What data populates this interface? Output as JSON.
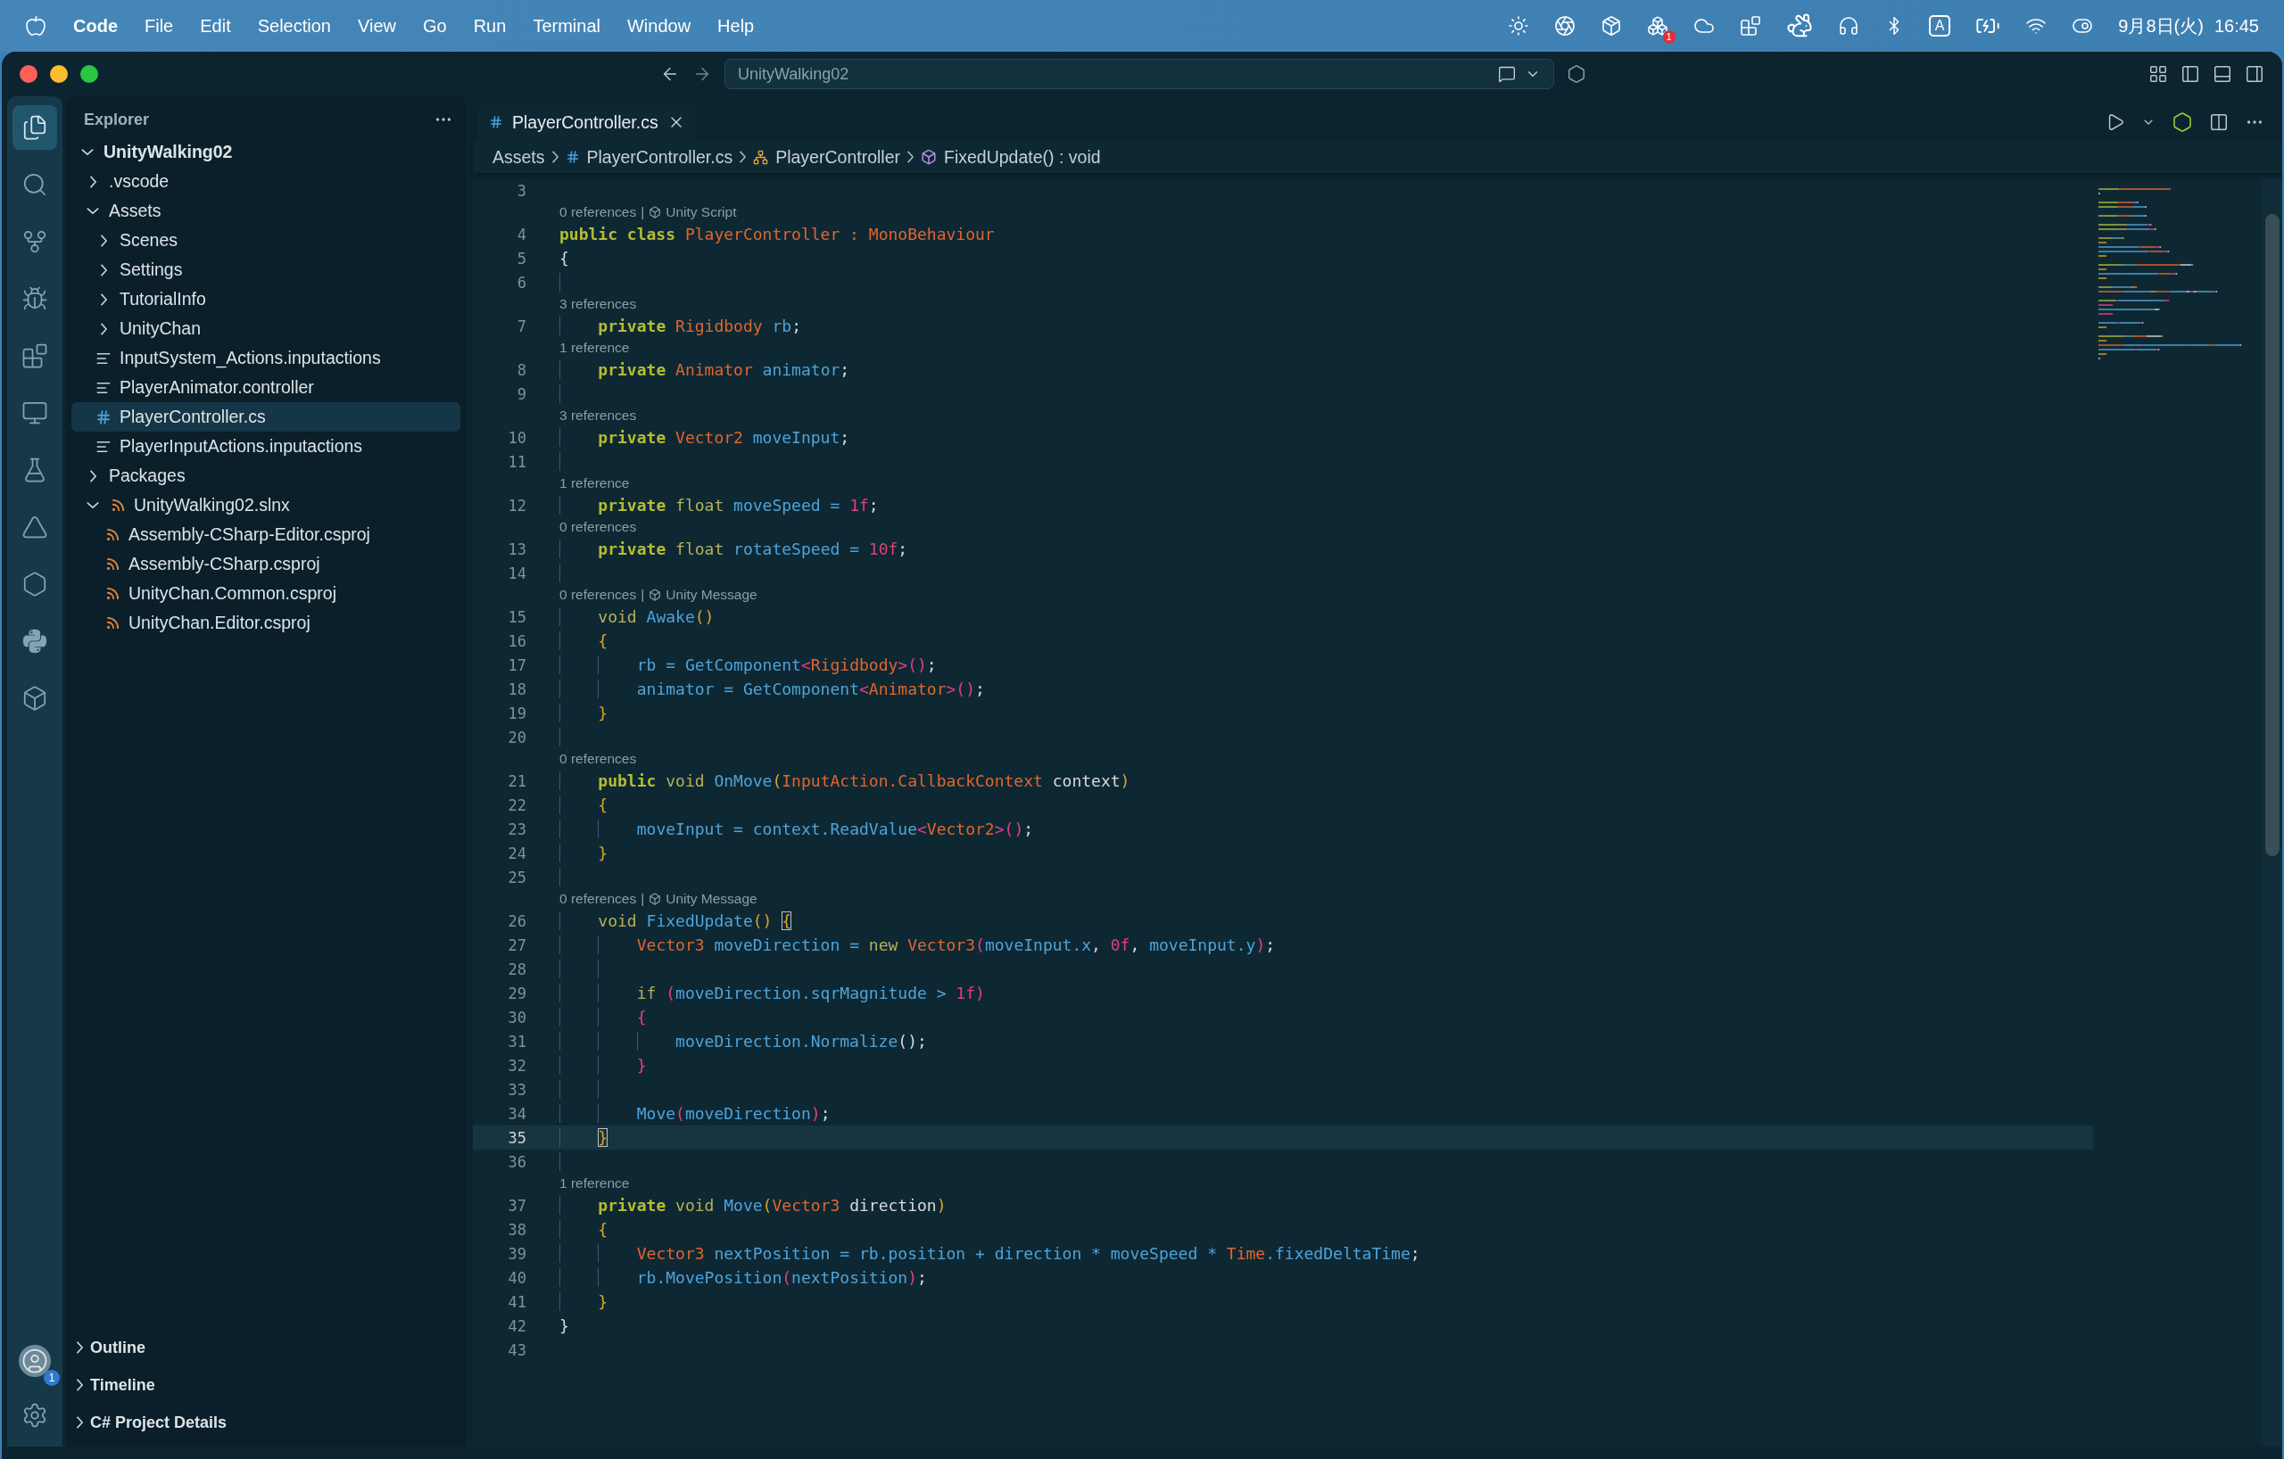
{
  "menu_bar": {
    "app": "Code",
    "items": [
      "File",
      "Edit",
      "Selection",
      "View",
      "Go",
      "Run",
      "Terminal",
      "Window",
      "Help"
    ],
    "tray_badge": "1",
    "input_mode": "A",
    "date": "9月8日(火)",
    "time": "16:45"
  },
  "title_bar": {
    "search": "UnityWalking02"
  },
  "activity_bar": [
    {
      "kind": "explorer",
      "selected": true
    },
    {
      "kind": "search",
      "selected": false
    },
    {
      "kind": "source-control",
      "selected": false
    },
    {
      "kind": "debug",
      "selected": false
    },
    {
      "kind": "extensions",
      "selected": false
    },
    {
      "kind": "remote",
      "selected": false
    },
    {
      "kind": "testing",
      "selected": false
    },
    {
      "kind": "triangle",
      "selected": false
    },
    {
      "kind": "hexagon",
      "selected": false
    },
    {
      "kind": "python",
      "selected": false
    },
    {
      "kind": "box",
      "selected": false
    }
  ],
  "account_badge": "1",
  "sidebar": {
    "title": "Explorer",
    "tree": [
      {
        "label": "UnityWalking02",
        "kind": "root",
        "expanded": true,
        "selected": false,
        "children": [
          {
            "label": ".vscode",
            "kind": "folder",
            "expanded": false,
            "selected": false
          },
          {
            "label": "Assets",
            "kind": "folder",
            "expanded": true,
            "selected": false,
            "children": [
              {
                "label": "Scenes",
                "kind": "folder",
                "expanded": false,
                "selected": false
              },
              {
                "label": "Settings",
                "kind": "folder",
                "expanded": false,
                "selected": false
              },
              {
                "label": "TutorialInfo",
                "kind": "folder",
                "expanded": false,
                "selected": false
              },
              {
                "label": "UnityChan",
                "kind": "folder",
                "expanded": false,
                "selected": false
              },
              {
                "label": "InputSystem_Actions.inputactions",
                "kind": "text",
                "selected": false
              },
              {
                "label": "PlayerAnimator.controller",
                "kind": "text",
                "selected": false
              },
              {
                "label": "PlayerController.cs",
                "kind": "csharp",
                "selected": true
              },
              {
                "label": "PlayerInputActions.inputactions",
                "kind": "text",
                "selected": false
              }
            ]
          },
          {
            "label": "Packages",
            "kind": "folder",
            "expanded": false,
            "selected": false
          },
          {
            "label": "UnityWalking02.slnx",
            "kind": "solution",
            "expanded": true,
            "selected": false,
            "children": [
              {
                "label": "Assembly-CSharp-Editor.csproj",
                "kind": "project",
                "selected": false
              },
              {
                "label": "Assembly-CSharp.csproj",
                "kind": "project",
                "selected": false
              },
              {
                "label": "UnityChan.Common.csproj",
                "kind": "project",
                "selected": false
              },
              {
                "label": "UnityChan.Editor.csproj",
                "kind": "project",
                "selected": false
              }
            ]
          }
        ]
      }
    ],
    "sections": [
      {
        "label": "Outline",
        "expanded": false
      },
      {
        "label": "Timeline",
        "expanded": false
      },
      {
        "label": "C# Project Details",
        "expanded": false
      }
    ]
  },
  "editor": {
    "tabs": [
      {
        "label": "PlayerController.cs",
        "selected": true
      }
    ],
    "breadcrumbs": [
      {
        "label": "Assets",
        "kind": "folder"
      },
      {
        "label": "PlayerController.cs",
        "kind": "csharp"
      },
      {
        "label": "PlayerController",
        "kind": "class"
      },
      {
        "label": "FixedUpdate() : void",
        "kind": "method"
      }
    ],
    "lines": [
      {
        "number": "3",
        "current": false
      },
      {
        "number": "4",
        "current": false,
        "lens": {
          "references": "0 references",
          "separator": "|",
          "tag": "Unity Script"
        },
        "tokens": [
          {
            "kind": "keyword",
            "text": "public class "
          },
          {
            "kind": "type",
            "text": "PlayerController : MonoBehaviour"
          }
        ]
      },
      {
        "number": "5",
        "current": false,
        "tokens": [
          {
            "kind": "plain",
            "text": "{"
          }
        ]
      },
      {
        "number": "6",
        "current": false
      },
      {
        "number": "7",
        "current": false,
        "lens": {
          "references": "3 references"
        },
        "tokens": [
          {
            "kind": "keyword",
            "text": "    private "
          },
          {
            "kind": "type",
            "text": "Rigidbody "
          },
          {
            "kind": "name",
            "text": "rb"
          },
          {
            "kind": "plain",
            "text": ";"
          }
        ]
      },
      {
        "number": "8",
        "current": false,
        "lens": {
          "references": "1 reference"
        },
        "tokens": [
          {
            "kind": "keyword",
            "text": "    private "
          },
          {
            "kind": "type",
            "text": "Animator "
          },
          {
            "kind": "name",
            "text": "animator"
          },
          {
            "kind": "plain",
            "text": ";"
          }
        ]
      },
      {
        "number": "9",
        "current": false
      },
      {
        "number": "10",
        "current": false,
        "lens": {
          "references": "3 references"
        },
        "tokens": [
          {
            "kind": "keyword",
            "text": "    private "
          },
          {
            "kind": "type",
            "text": "Vector2 "
          },
          {
            "kind": "name",
            "text": "moveInput"
          },
          {
            "kind": "plain",
            "text": ";"
          }
        ]
      },
      {
        "number": "11",
        "current": false
      },
      {
        "number": "12",
        "current": false,
        "lens": {
          "references": "1 reference"
        },
        "tokens": [
          {
            "kind": "keyword",
            "text": "    private "
          },
          {
            "kind": "modifier",
            "text": "float "
          },
          {
            "kind": "name",
            "text": "moveSpeed"
          },
          {
            "kind": "operator",
            "text": " = "
          },
          {
            "kind": "number",
            "text": "1f"
          },
          {
            "kind": "plain",
            "text": ";"
          }
        ]
      },
      {
        "number": "13",
        "current": false,
        "lens": {
          "references": "0 references"
        },
        "tokens": [
          {
            "kind": "keyword",
            "text": "    private "
          },
          {
            "kind": "modifier",
            "text": "float "
          },
          {
            "kind": "name",
            "text": "rotateSpeed"
          },
          {
            "kind": "operator",
            "text": " = "
          },
          {
            "kind": "number",
            "text": "10f"
          },
          {
            "kind": "plain",
            "text": ";"
          }
        ]
      },
      {
        "number": "14",
        "current": false
      },
      {
        "number": "15",
        "current": false,
        "lens": {
          "references": "0 references",
          "separator": "|",
          "tag": "Unity Message"
        },
        "tokens": [
          {
            "kind": "modifier",
            "text": "    void "
          },
          {
            "kind": "name",
            "text": "Awake"
          },
          {
            "kind": "brace",
            "text": "()"
          }
        ]
      },
      {
        "number": "16",
        "current": false,
        "tokens": [
          {
            "kind": "brace",
            "text": "    {"
          }
        ]
      },
      {
        "number": "17",
        "current": false,
        "tokens": [
          {
            "kind": "name",
            "text": "        rb"
          },
          {
            "kind": "operator",
            "text": " = "
          },
          {
            "kind": "name",
            "text": "GetComponent"
          },
          {
            "kind": "bracket",
            "text": "<"
          },
          {
            "kind": "type",
            "text": "Rigidbody"
          },
          {
            "kind": "bracket",
            "text": ">()"
          },
          {
            "kind": "plain",
            "text": ";"
          }
        ]
      },
      {
        "number": "18",
        "current": false,
        "tokens": [
          {
            "kind": "name",
            "text": "        animator"
          },
          {
            "kind": "operator",
            "text": " = "
          },
          {
            "kind": "name",
            "text": "GetComponent"
          },
          {
            "kind": "bracket",
            "text": "<"
          },
          {
            "kind": "type",
            "text": "Animator"
          },
          {
            "kind": "bracket",
            "text": ">()"
          },
          {
            "kind": "plain",
            "text": ";"
          }
        ]
      },
      {
        "number": "19",
        "current": false,
        "tokens": [
          {
            "kind": "brace",
            "text": "    }"
          }
        ]
      },
      {
        "number": "20",
        "current": false
      },
      {
        "number": "21",
        "current": false,
        "lens": {
          "references": "0 references"
        },
        "tokens": [
          {
            "kind": "keyword",
            "text": "    public "
          },
          {
            "kind": "modifier",
            "text": "void "
          },
          {
            "kind": "name",
            "text": "OnMove"
          },
          {
            "kind": "brace",
            "text": "("
          },
          {
            "kind": "type",
            "text": "InputAction.CallbackContext "
          },
          {
            "kind": "plain",
            "text": "context"
          },
          {
            "kind": "brace",
            "text": ")"
          }
        ]
      },
      {
        "number": "22",
        "current": false,
        "tokens": [
          {
            "kind": "brace",
            "text": "    {"
          }
        ]
      },
      {
        "number": "23",
        "current": false,
        "tokens": [
          {
            "kind": "name",
            "text": "        moveInput"
          },
          {
            "kind": "operator",
            "text": " = "
          },
          {
            "kind": "name",
            "text": "context.ReadValue"
          },
          {
            "kind": "bracket",
            "text": "<"
          },
          {
            "kind": "type",
            "text": "Vector2"
          },
          {
            "kind": "bracket",
            "text": ">()"
          },
          {
            "kind": "plain",
            "text": ";"
          }
        ]
      },
      {
        "number": "24",
        "current": false,
        "tokens": [
          {
            "kind": "brace",
            "text": "    }"
          }
        ]
      },
      {
        "number": "25",
        "current": false
      },
      {
        "number": "26",
        "current": false,
        "lens": {
          "references": "0 references",
          "separator": "|",
          "tag": "Unity Message"
        },
        "tokens": [
          {
            "kind": "modifier",
            "text": "    void "
          },
          {
            "kind": "name",
            "text": "FixedUpdate"
          },
          {
            "kind": "brace",
            "text": "() "
          },
          {
            "kind": "match",
            "text": "{"
          }
        ]
      },
      {
        "number": "27",
        "current": false,
        "tokens": [
          {
            "kind": "type",
            "text": "        Vector3 "
          },
          {
            "kind": "name",
            "text": "moveDirection"
          },
          {
            "kind": "operator",
            "text": " = "
          },
          {
            "kind": "modifier",
            "text": "new "
          },
          {
            "kind": "type",
            "text": "Vector3"
          },
          {
            "kind": "bracket",
            "text": "("
          },
          {
            "kind": "name",
            "text": "moveInput.x"
          },
          {
            "kind": "plain",
            "text": ", "
          },
          {
            "kind": "number",
            "text": "0f"
          },
          {
            "kind": "plain",
            "text": ", "
          },
          {
            "kind": "name",
            "text": "moveInput.y"
          },
          {
            "kind": "bracket",
            "text": ")"
          },
          {
            "kind": "plain",
            "text": ";"
          }
        ]
      },
      {
        "number": "28",
        "current": false
      },
      {
        "number": "29",
        "current": false,
        "tokens": [
          {
            "kind": "modifier",
            "text": "        if "
          },
          {
            "kind": "bracket",
            "text": "("
          },
          {
            "kind": "name",
            "text": "moveDirection.sqrMagnitude"
          },
          {
            "kind": "operator",
            "text": " > "
          },
          {
            "kind": "number",
            "text": "1f"
          },
          {
            "kind": "bracket",
            "text": ")"
          }
        ]
      },
      {
        "number": "30",
        "current": false,
        "tokens": [
          {
            "kind": "bracket",
            "text": "        {"
          }
        ]
      },
      {
        "number": "31",
        "current": false,
        "tokens": [
          {
            "kind": "name",
            "text": "            moveDirection.Normalize"
          },
          {
            "kind": "plain",
            "text": "();"
          }
        ]
      },
      {
        "number": "32",
        "current": false,
        "tokens": [
          {
            "kind": "bracket",
            "text": "        }"
          }
        ]
      },
      {
        "number": "33",
        "current": false
      },
      {
        "number": "34",
        "current": false,
        "tokens": [
          {
            "kind": "name",
            "text": "        Move"
          },
          {
            "kind": "bracket",
            "text": "("
          },
          {
            "kind": "name",
            "text": "moveDirection"
          },
          {
            "kind": "bracket",
            "text": ")"
          },
          {
            "kind": "plain",
            "text": ";"
          }
        ]
      },
      {
        "number": "35",
        "current": true,
        "tokens": [
          {
            "kind": "match",
            "text": "    }"
          }
        ]
      },
      {
        "number": "36",
        "current": false
      },
      {
        "number": "37",
        "current": false,
        "lens": {
          "references": "1 reference"
        },
        "tokens": [
          {
            "kind": "keyword",
            "text": "    private "
          },
          {
            "kind": "modifier",
            "text": "void "
          },
          {
            "kind": "name",
            "text": "Move"
          },
          {
            "kind": "brace",
            "text": "("
          },
          {
            "kind": "type",
            "text": "Vector3 "
          },
          {
            "kind": "plain",
            "text": "direction"
          },
          {
            "kind": "brace",
            "text": ")"
          }
        ]
      },
      {
        "number": "38",
        "current": false,
        "tokens": [
          {
            "kind": "brace",
            "text": "    {"
          }
        ]
      },
      {
        "number": "39",
        "current": false,
        "tokens": [
          {
            "kind": "type",
            "text": "        Vector3 "
          },
          {
            "kind": "name",
            "text": "nextPosition"
          },
          {
            "kind": "operator",
            "text": " = "
          },
          {
            "kind": "name",
            "text": "rb.position"
          },
          {
            "kind": "operator",
            "text": " + "
          },
          {
            "kind": "name",
            "text": "direction"
          },
          {
            "kind": "operator",
            "text": " * "
          },
          {
            "kind": "name",
            "text": "moveSpeed"
          },
          {
            "kind": "operator",
            "text": " * "
          },
          {
            "kind": "type",
            "text": "Time"
          },
          {
            "kind": "name",
            "text": ".fixedDeltaTime"
          },
          {
            "kind": "plain",
            "text": ";"
          }
        ]
      },
      {
        "number": "40",
        "current": false,
        "tokens": [
          {
            "kind": "name",
            "text": "        rb.MovePosition"
          },
          {
            "kind": "bracket",
            "text": "("
          },
          {
            "kind": "name",
            "text": "nextPosition"
          },
          {
            "kind": "bracket",
            "text": ")"
          },
          {
            "kind": "plain",
            "text": ";"
          }
        ]
      },
      {
        "number": "41",
        "current": false,
        "tokens": [
          {
            "kind": "brace",
            "text": "    }"
          }
        ]
      },
      {
        "number": "42",
        "current": false,
        "tokens": [
          {
            "kind": "plain",
            "text": "}"
          }
        ]
      },
      {
        "number": "43",
        "current": false
      }
    ]
  }
}
